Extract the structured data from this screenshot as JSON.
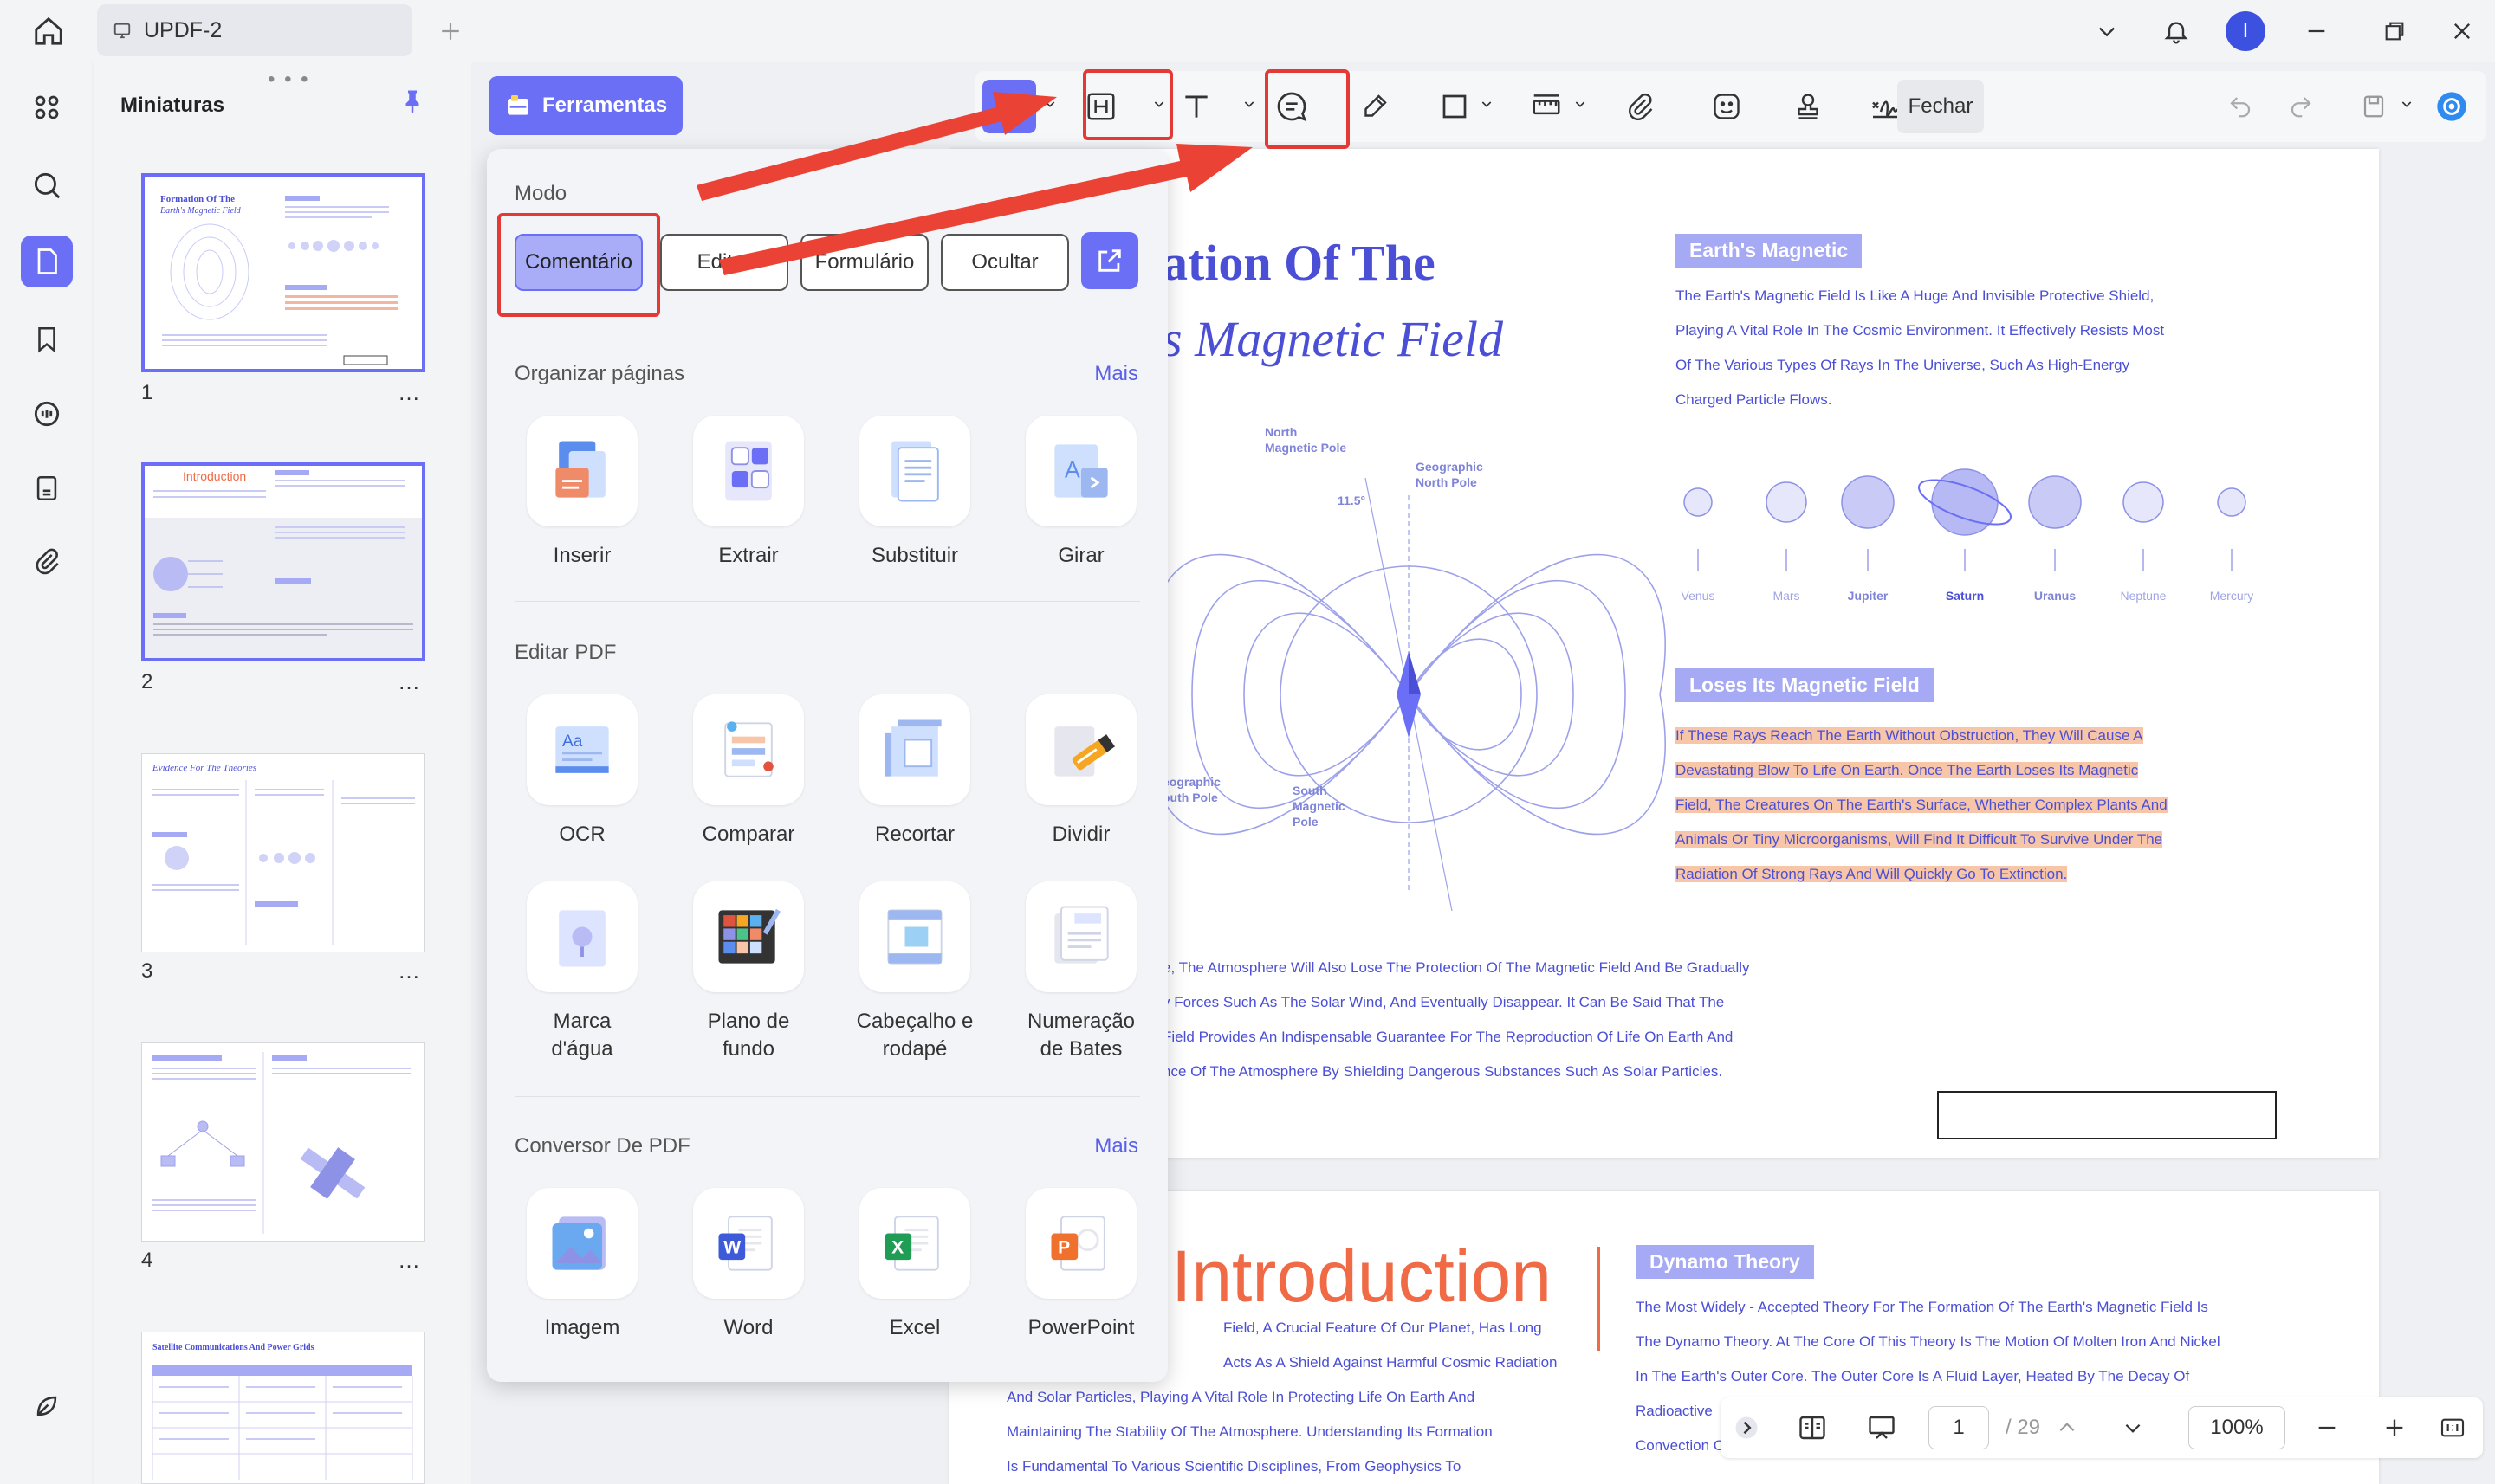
{
  "titlebar": {
    "tab_title": "UPDF-2",
    "avatar_letter": "I"
  },
  "thumbnails": {
    "title": "Miniaturas",
    "more": "…",
    "pages": [
      {
        "number": "1",
        "heading_a": "Formation Of The",
        "heading_b": "Earth's Magnetic Field"
      },
      {
        "number": "2",
        "heading_a": "Introduction"
      },
      {
        "number": "3",
        "heading_a": "Evidence For The Theories"
      },
      {
        "number": "4"
      },
      {
        "number": "",
        "heading_a": "Satellite Communications And Power Grids"
      }
    ]
  },
  "toolbar": {
    "tools_label": "Ferramentas",
    "close_label": "Fechar"
  },
  "dropdown": {
    "mode_title": "Modo",
    "modes": [
      "Comentário",
      "Editar",
      "Formulário",
      "Ocultar"
    ],
    "organize_title": "Organizar páginas",
    "organize_more": "Mais",
    "organize_items": [
      "Inserir",
      "Extrair",
      "Substituir",
      "Girar"
    ],
    "edit_title": "Editar PDF",
    "edit_items": [
      "OCR",
      "Comparar",
      "Recortar",
      "Dividir"
    ],
    "edit_items2": [
      "Marca\nd'água",
      "Plano de\nfundo",
      "Cabeçalho e\nrodapé",
      "Numeração\nde Bates"
    ],
    "convert_title": "Conversor De PDF",
    "convert_more": "Mais",
    "convert_items": [
      "Imagem",
      "Word",
      "Excel",
      "PowerPoint"
    ]
  },
  "document": {
    "page1": {
      "title_line1": "ation Of The",
      "title_line2": "s Magnetic Field",
      "tag1": "Earth's Magnetic",
      "para1": [
        "The Earth's Magnetic Field Is Like A Huge And Invisible Protective Shield,",
        "Playing A Vital Role In The Cosmic Environment. It Effectively Resists Most",
        "Of The Various Types Of Rays In The Universe, Such As High-Energy",
        "Charged Particle Flows."
      ],
      "planets": [
        "Venus",
        "Mars",
        "Jupiter",
        "Saturn",
        "Uranus",
        "Neptune",
        "Mercury"
      ],
      "diagram_labels": {
        "north_magnetic": "North\nMagnetic Pole",
        "geo_north": "Geographic\nNorth Pole",
        "angle": "11.5°",
        "geo_south": "eographic\nouth Pole",
        "south_magnetic": "South\nMagnetic\nPole"
      },
      "tag2": "Loses Its Magnetic Field",
      "para2": [
        "If These Rays Reach The Earth Without Obstruction, They Will Cause A",
        "Devastating Blow To Life On Earth. Once The Earth Loses Its Magnetic",
        "Field, The Creatures On The Earth's Surface, Whether Complex Plants And",
        "Animals Or Tiny Microorganisms, Will Find It Difficult To Survive Under The",
        "Radiation Of Strong Rays And Will Quickly Go To Extinction."
      ],
      "para3": [
        "e, The Atmosphere Will Also Lose The Protection Of The Magnetic Field And Be Gradually",
        "y Forces Such As The Solar Wind, And Eventually Disappear. It Can Be Said That The",
        "Field Provides An Indispensable Guarantee For The Reproduction Of Life On Earth And",
        "nce Of The Atmosphere By Shielding Dangerous Substances Such As Solar Particles."
      ]
    },
    "page2": {
      "title": "Introduction",
      "tag": "Dynamo Theory",
      "left_para": [
        "Field, A Crucial Feature Of Our Planet, Has Long",
        "Acts As A Shield Against Harmful Cosmic Radiation",
        "And Solar Particles, Playing A Vital Role In Protecting Life On Earth And",
        "Maintaining The Stability Of The Atmosphere. Understanding Its Formation",
        "Is Fundamental To Various Scientific Disciplines, From Geophysics To"
      ],
      "right_para": [
        "The Most Widely - Accepted Theory For The Formation Of The Earth's Magnetic Field Is",
        "The Dynamo Theory. At The Core Of This Theory Is The Motion Of Molten Iron And Nickel",
        "In The Earth's Outer Core. The Outer Core Is A Fluid Layer, Heated By The Decay Of",
        "Radioactive",
        "Convection Currents Within The Fluid."
      ]
    }
  },
  "bottom_nav": {
    "page": "1",
    "total": "/ 29",
    "zoom": "100%"
  },
  "colors": {
    "accent": "#6a6ff5",
    "annotation": "#e53935",
    "doc_text": "#4b4fd6",
    "intro_title": "#ef6a45"
  }
}
